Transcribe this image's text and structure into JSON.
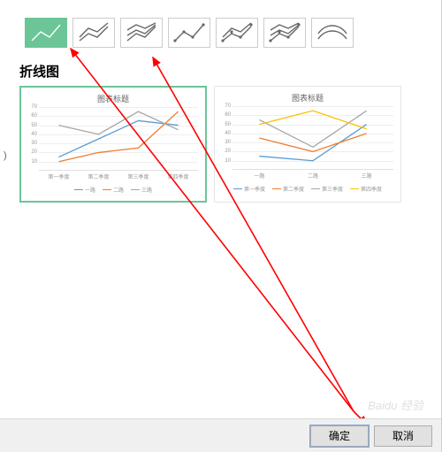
{
  "section_title": "折线图",
  "chart_types": [
    {
      "name": "line-basic",
      "selected": true
    },
    {
      "name": "line-stacked",
      "selected": false
    },
    {
      "name": "line-100stacked",
      "selected": false
    },
    {
      "name": "line-markers",
      "selected": false
    },
    {
      "name": "line-stacked-markers",
      "selected": false
    },
    {
      "name": "line-100stacked-markers",
      "selected": false
    },
    {
      "name": "line-3d",
      "selected": false
    }
  ],
  "preview1": {
    "title": "图表标题",
    "yticks": [
      70,
      60,
      50,
      40,
      30,
      20,
      10
    ],
    "x": [
      "第一季度",
      "第二季度",
      "第三季度",
      "第四季度"
    ],
    "legend": [
      {
        "label": "一路",
        "color": "#5b9bd5"
      },
      {
        "label": "二路",
        "color": "#ed7d31"
      },
      {
        "label": "三路",
        "color": "#a5a5a5"
      }
    ]
  },
  "preview2": {
    "title": "图表标题",
    "yticks": [
      70,
      60,
      50,
      40,
      30,
      20,
      10
    ],
    "x": [
      "一路",
      "二路",
      "三路"
    ],
    "legend": [
      {
        "label": "第一季度",
        "color": "#5b9bd5"
      },
      {
        "label": "第二季度",
        "color": "#ed7d31"
      },
      {
        "label": "第三季度",
        "color": "#a5a5a5"
      },
      {
        "label": "第四季度",
        "color": "#ffc000"
      }
    ]
  },
  "chart_data": [
    {
      "type": "line",
      "title": "图表标题",
      "categories": [
        "第一季度",
        "第二季度",
        "第三季度",
        "第四季度"
      ],
      "series": [
        {
          "name": "一路",
          "values": [
            15,
            35,
            55,
            50
          ],
          "color": "#5b9bd5"
        },
        {
          "name": "二路",
          "values": [
            10,
            20,
            25,
            65
          ],
          "color": "#ed7d31"
        },
        {
          "name": "三路",
          "values": [
            50,
            40,
            65,
            45
          ],
          "color": "#a5a5a5"
        }
      ],
      "xlabel": "",
      "ylabel": "",
      "ylim": [
        0,
        70
      ]
    },
    {
      "type": "line",
      "title": "图表标题",
      "categories": [
        "一路",
        "二路",
        "三路"
      ],
      "series": [
        {
          "name": "第一季度",
          "values": [
            15,
            10,
            50
          ],
          "color": "#5b9bd5"
        },
        {
          "name": "第二季度",
          "values": [
            35,
            20,
            40
          ],
          "color": "#ed7d31"
        },
        {
          "name": "第三季度",
          "values": [
            55,
            25,
            65
          ],
          "color": "#a5a5a5"
        },
        {
          "name": "第四季度",
          "values": [
            50,
            65,
            45
          ],
          "color": "#ffc000"
        }
      ],
      "xlabel": "",
      "ylabel": "",
      "ylim": [
        0,
        70
      ]
    }
  ],
  "buttons": {
    "ok": "确定",
    "cancel": "取消"
  },
  "watermark": "Baidu 经验",
  "paren": ")"
}
